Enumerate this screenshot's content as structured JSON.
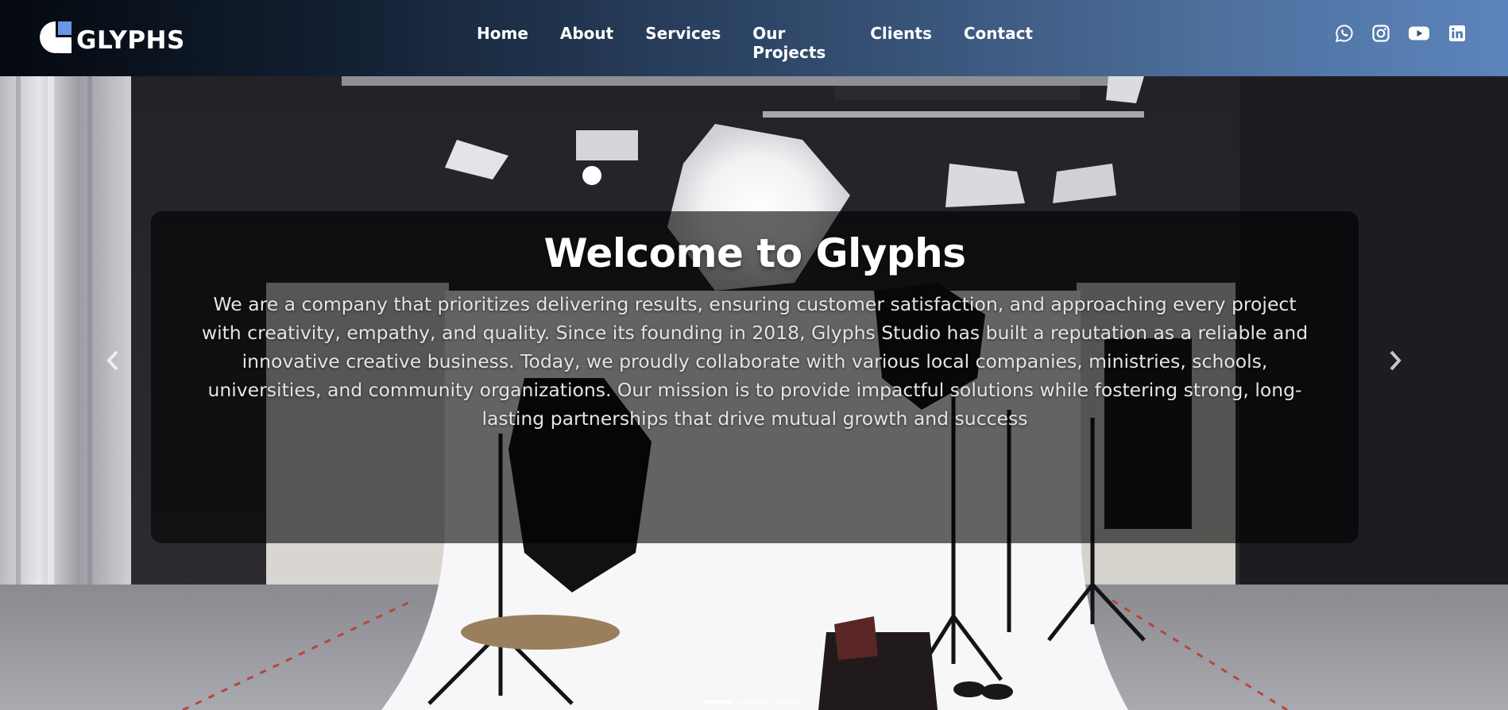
{
  "brand": {
    "name": "GLYPHS",
    "logo_icon": "glyphs-logo-mark"
  },
  "nav": {
    "links": [
      {
        "label": "Home"
      },
      {
        "label": "About"
      },
      {
        "label": "Services"
      },
      {
        "label": "Our Projects"
      },
      {
        "label": "Clients"
      },
      {
        "label": "Contact"
      }
    ]
  },
  "social": [
    {
      "icon": "whatsapp-icon"
    },
    {
      "icon": "instagram-icon"
    },
    {
      "icon": "youtube-icon"
    },
    {
      "icon": "linkedin-icon"
    }
  ],
  "hero": {
    "title": "Welcome to Glyphs",
    "description": "We are a company that prioritizes delivering results, ensuring customer satisfaction, and approaching every project with creativity, empathy, and quality. Since its founding in 2018, Glyphs Studio has built a reputation as a reliable and innovative creative business. Today, we proudly collaborate with various local companies, ministries, schools, universities, and community organizations. Our mission is to provide impactful solutions while fostering strong, long-lasting partnerships that drive mutual growth and success",
    "background": "photo studio with lighting equipment",
    "slides_total": 3,
    "active_slide": 1
  },
  "colors": {
    "nav_gradient_start": "#05090f",
    "nav_gradient_end": "#5c84bc",
    "logo_accent": "#6b95e6",
    "text": "#ffffff"
  }
}
